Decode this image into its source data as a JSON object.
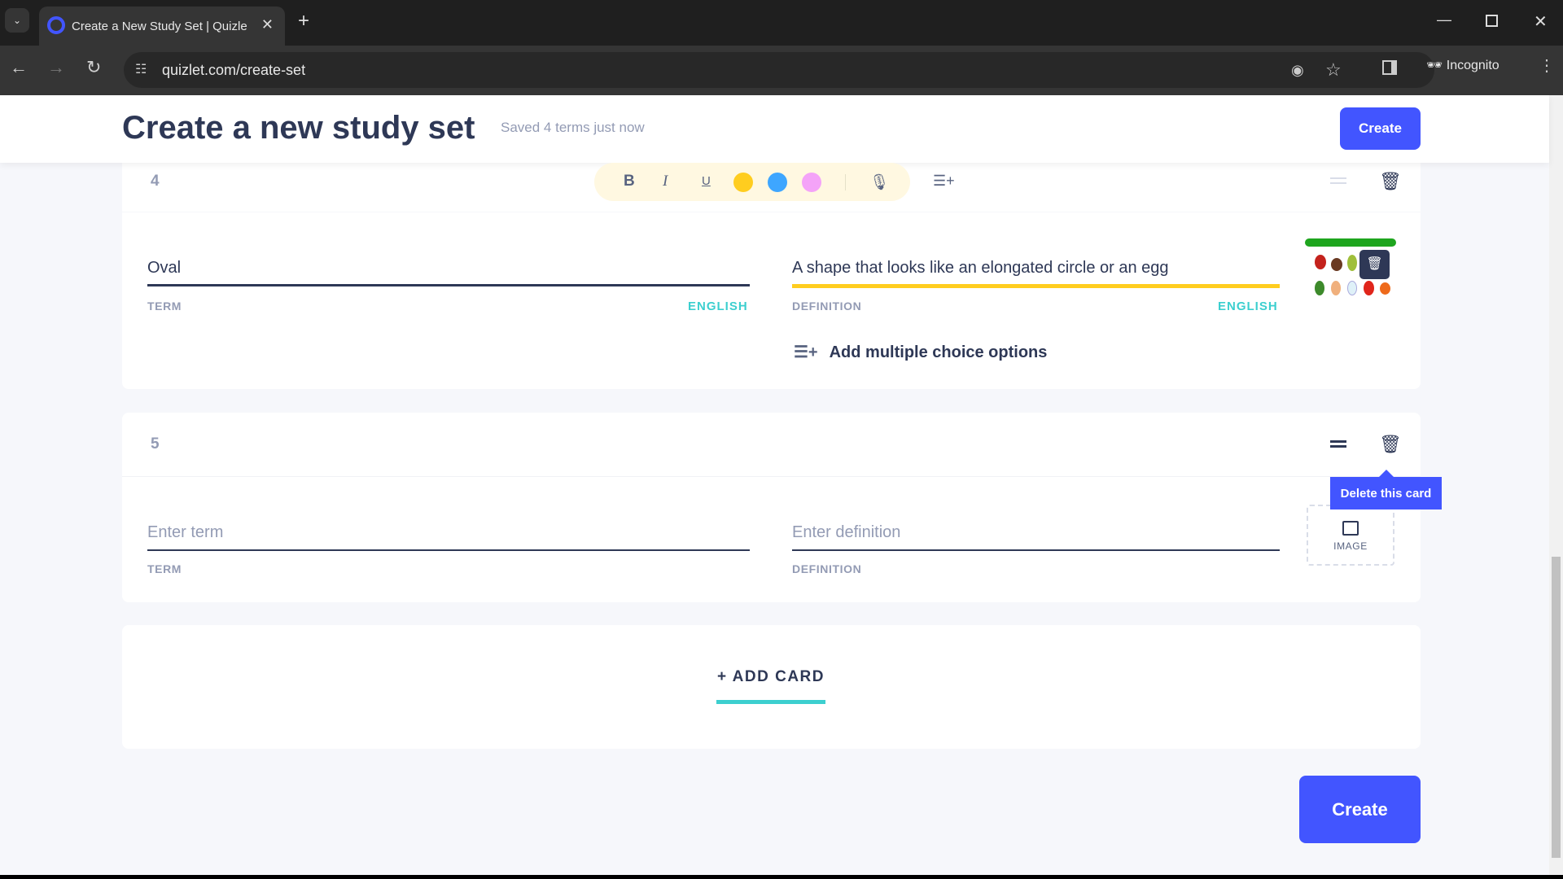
{
  "browser": {
    "tab_title": "Create a New Study Set | Quizle",
    "url": "quizlet.com/create-set",
    "incognito_label": "Incognito"
  },
  "header": {
    "title": "Create a new study set",
    "saved_status": "Saved 4 terms just now",
    "create_label": "Create"
  },
  "toolbar": {
    "bold": "B",
    "italic": "I",
    "underline": "U",
    "colors": [
      "#ffcd1f",
      "#3ea6ff",
      "#f4a3f8"
    ]
  },
  "cards": [
    {
      "number": "4",
      "term": "Oval",
      "definition": "A shape that looks like an elongated circle or an egg",
      "term_label": "TERM",
      "definition_label": "DEFINITION",
      "term_lang": "ENGLISH",
      "definition_lang": "ENGLISH",
      "mc_label": "Add multiple choice options"
    },
    {
      "number": "5",
      "term_placeholder": "Enter term",
      "definition_placeholder": "Enter definition",
      "term_label": "TERM",
      "definition_label": "DEFINITION",
      "image_label": "IMAGE",
      "tooltip": "Delete this card"
    }
  ],
  "add_card_label": "+ ADD CARD",
  "create_label": "Create",
  "colors": {
    "accent": "#4255ff",
    "lang": "#3ccfcf",
    "focus_underline": "#ffcd1f"
  }
}
